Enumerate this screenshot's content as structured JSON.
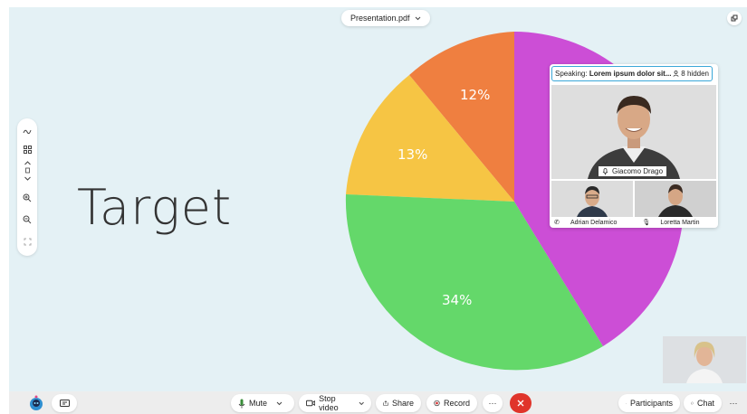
{
  "file_menu": {
    "label": "Presentation.pdf"
  },
  "slide": {
    "title": "Target",
    "pie": [
      {
        "label": "12%",
        "value": 12,
        "color": "#ef7f40"
      },
      {
        "label": "13%",
        "value": 13,
        "color": "#f6c544"
      },
      {
        "label": "34%",
        "value": 34,
        "color": "#64d86a"
      },
      {
        "label": "",
        "value": 41,
        "color": "#cc4ed6"
      }
    ]
  },
  "video_panel": {
    "speaking_prefix": "Speaking:",
    "speaking_name": "Lorem ipsum dolor sit...",
    "hidden": "8 hidden",
    "main_participant": "Giacomo Drago",
    "thumbs": [
      "Adrian Delamico",
      "Loretta Martin"
    ]
  },
  "toolbar": {
    "mute": "Mute",
    "stop_video": "Stop video",
    "share": "Share",
    "record": "Record",
    "more": "···",
    "participants": "Participants",
    "chat": "Chat"
  },
  "colors": {
    "accent": "#3aa7d8",
    "end_call": "#e0342a",
    "record": "#d43a3a"
  }
}
